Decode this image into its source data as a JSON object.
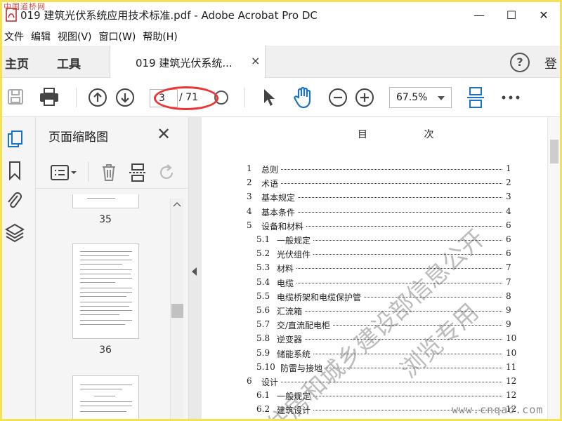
{
  "window": {
    "title": "019 建筑光伏系统应用技术标准.pdf - Adobe Acrobat Pro DC",
    "site_mark": "中国道桥网",
    "minimize": "—",
    "maximize": "☐",
    "close": "✕"
  },
  "menu": [
    "文件",
    "编辑",
    "视图(V)",
    "窗口(W)",
    "帮助(H)"
  ],
  "tabs": {
    "home": "主页",
    "tools": "工具",
    "doc": "019 建筑光伏系统...",
    "doc_close": "×",
    "help": "?",
    "signin": "登"
  },
  "toolbar": {
    "page_current": "3",
    "page_total": "/ 71",
    "zoom": "67.5%",
    "icons": [
      "save-icon",
      "print-icon",
      "prev-page-icon",
      "next-page-icon",
      "select-arrow-icon",
      "hand-icon",
      "zoom-out-icon",
      "zoom-in-icon",
      "scroll-mode-icon",
      "more-icon"
    ]
  },
  "panel": {
    "title": "页面缩略图",
    "close": "✕",
    "thumbs": [
      {
        "label": "35"
      },
      {
        "label": "36"
      }
    ]
  },
  "toc": {
    "heading": "目 次",
    "entries": [
      {
        "num": "1",
        "text": "总则",
        "page": "1",
        "indent": false
      },
      {
        "num": "2",
        "text": "术语",
        "page": "2",
        "indent": false
      },
      {
        "num": "3",
        "text": "基本规定",
        "page": "3",
        "indent": false
      },
      {
        "num": "4",
        "text": "基本条件",
        "page": "4",
        "indent": false
      },
      {
        "num": "5",
        "text": "设备和材料",
        "page": "6",
        "indent": false
      },
      {
        "num": "5.1",
        "text": "一般规定",
        "page": "6",
        "indent": true
      },
      {
        "num": "5.2",
        "text": "光伏组件",
        "page": "6",
        "indent": true
      },
      {
        "num": "5.3",
        "text": "材料",
        "page": "7",
        "indent": true
      },
      {
        "num": "5.4",
        "text": "电缆",
        "page": "7",
        "indent": true
      },
      {
        "num": "5.5",
        "text": "电缆桥架和电缆保护管",
        "page": "8",
        "indent": true
      },
      {
        "num": "5.6",
        "text": "汇流箱",
        "page": "9",
        "indent": true
      },
      {
        "num": "5.7",
        "text": "交/直流配电柜",
        "page": "9",
        "indent": true
      },
      {
        "num": "5.8",
        "text": "逆变器",
        "page": "10",
        "indent": true
      },
      {
        "num": "5.9",
        "text": "储能系统",
        "page": "10",
        "indent": true
      },
      {
        "num": "5.10",
        "text": "防雷与接地",
        "page": "11",
        "indent": true
      },
      {
        "num": "6",
        "text": "设计",
        "page": "12",
        "indent": false
      },
      {
        "num": "6.1",
        "text": "一般规定",
        "page": "12",
        "indent": true
      },
      {
        "num": "6.2",
        "text": "建筑设计",
        "page": "12",
        "indent": true
      }
    ]
  },
  "watermarks": {
    "line1": "住房和城乡建设部信息公开",
    "line2": "浏览专用",
    "bottom": "www.cnqao.com"
  }
}
